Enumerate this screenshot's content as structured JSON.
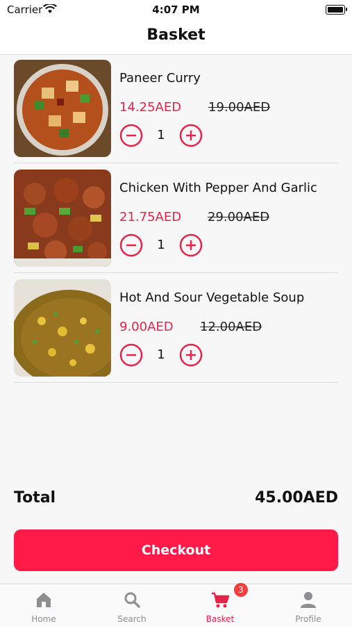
{
  "status_bar": {
    "carrier": "Carrier",
    "time": "4:07 PM"
  },
  "header": {
    "title": "Basket"
  },
  "items": [
    {
      "name": "Paneer Curry",
      "price": "14.25AED",
      "old_price": "19.00AED",
      "quantity": "1"
    },
    {
      "name": "Chicken With Pepper And Garlic",
      "price": "21.75AED",
      "old_price": "29.00AED",
      "quantity": "1"
    },
    {
      "name": "Hot And Sour Vegetable Soup",
      "price": "9.00AED",
      "old_price": "12.00AED",
      "quantity": "1"
    }
  ],
  "summary": {
    "total_label": "Total",
    "total_value": "45.00AED"
  },
  "checkout": {
    "label": "Checkout"
  },
  "tabs": [
    {
      "label": "Home",
      "icon": "home-icon"
    },
    {
      "label": "Search",
      "icon": "search-icon"
    },
    {
      "label": "Basket",
      "icon": "cart-icon",
      "badge": "3",
      "active": true
    },
    {
      "label": "Profile",
      "icon": "person-icon"
    }
  ],
  "colors": {
    "accent": "#e8234a",
    "checkout_bg": "#ff1a47",
    "badge": "#f53e3e",
    "tab_inactive": "#8e8e93"
  }
}
